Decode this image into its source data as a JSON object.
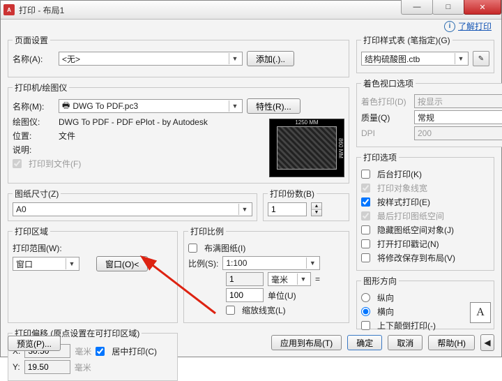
{
  "window": {
    "app_badge": "A",
    "title": "打印 - 布局1"
  },
  "info": {
    "link": "了解打印"
  },
  "page_setup": {
    "legend": "页面设置",
    "name_label": "名称(A):",
    "name_value": "<无>",
    "add_btn": "添加(.).."
  },
  "printer": {
    "legend": "打印机/绘图仪",
    "name_label": "名称(M):",
    "name_value": "DWG To PDF.pc3",
    "props_btn": "特性(R)...",
    "plotter_label": "绘图仪:",
    "plotter_value": "DWG To PDF - PDF ePlot - by Autodesk",
    "where_label": "位置:",
    "where_value": "文件",
    "desc_label": "说明:",
    "to_file": "打印到文件(F)",
    "preview_dim_top": "1250 MM",
    "preview_dim_right": "860 MM"
  },
  "paper": {
    "legend": "图纸尺寸(Z)",
    "value": "A0"
  },
  "copies": {
    "legend": "打印份数(B)",
    "value": "1"
  },
  "area": {
    "legend": "打印区域",
    "range_label": "打印范围(W):",
    "range_value": "窗口",
    "window_btn": "窗口(O)<"
  },
  "scale": {
    "legend": "打印比例",
    "fit": "布满图纸(I)",
    "scale_label": "比例(S):",
    "scale_value": "1:100",
    "unit_top": "1",
    "unit_top_label": "毫米",
    "unit_bottom": "100",
    "unit_bottom_label": "单位(U)",
    "lineweight": "缩放线宽(L)"
  },
  "offset": {
    "legend": "打印偏移 (原点设置在可打印区域)",
    "x_label": "X:",
    "x_value": "30.50",
    "y_label": "Y:",
    "y_value": "19.50",
    "unit": "毫米",
    "center": "居中打印(C)"
  },
  "style": {
    "legend": "打印样式表 (笔指定)(G)",
    "value": "结构硫酸图.ctb"
  },
  "viewport": {
    "legend": "着色视口选项",
    "shade_label": "着色打印(D)",
    "shade_value": "按显示",
    "quality_label": "质量(Q)",
    "quality_value": "常规",
    "dpi_label": "DPI",
    "dpi_value": "200"
  },
  "options": {
    "legend": "打印选项",
    "items": [
      {
        "label": "后台打印(K)",
        "checked": false,
        "enabled": true
      },
      {
        "label": "打印对象线宽",
        "checked": true,
        "enabled": false
      },
      {
        "label": "按样式打印(E)",
        "checked": true,
        "enabled": true
      },
      {
        "label": "最后打印图纸空间",
        "checked": true,
        "enabled": false
      },
      {
        "label": "隐藏图纸空间对象(J)",
        "checked": false,
        "enabled": true
      },
      {
        "label": "打开打印戳记(N)",
        "checked": false,
        "enabled": true
      },
      {
        "label": "将修改保存到布局(V)",
        "checked": false,
        "enabled": true
      }
    ]
  },
  "orient": {
    "legend": "图形方向",
    "portrait": "纵向",
    "landscape": "横向",
    "upside": "上下颠倒打印(-)",
    "glyph": "A"
  },
  "footer": {
    "preview": "预览(P)...",
    "apply": "应用到布局(T)",
    "ok": "确定",
    "cancel": "取消",
    "help": "帮助(H)"
  }
}
